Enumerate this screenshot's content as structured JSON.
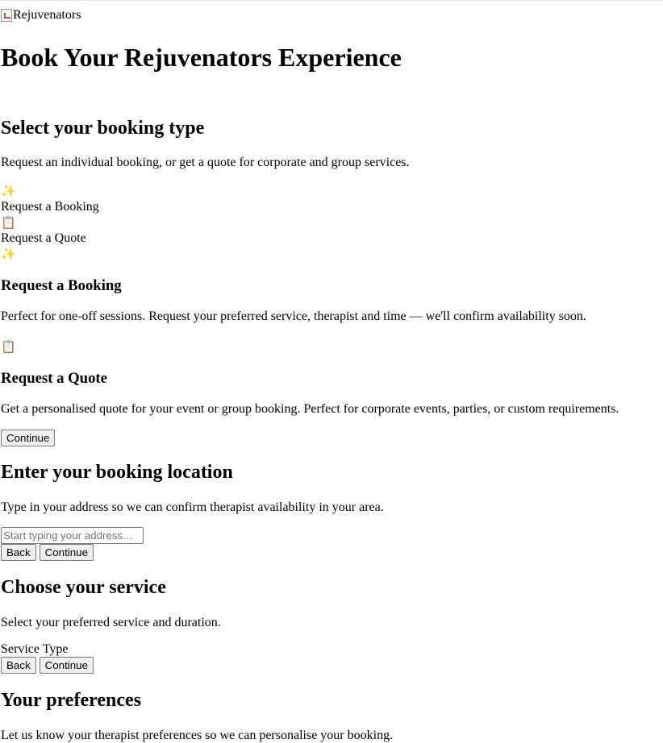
{
  "header": {
    "logo_alt": "Rejuvenators",
    "title": "Book Your Rejuvenators Experience"
  },
  "step_type": {
    "heading": "Select your booking type",
    "description": "Request an individual booking, or get a quote for corporate and group services.",
    "tabs": [
      {
        "icon": "sparkles-icon",
        "glyph": "✨",
        "label": "Request a Booking"
      },
      {
        "icon": "clipboard-icon",
        "glyph": "📋",
        "label": "Request a Quote"
      }
    ],
    "cards": [
      {
        "icon": "sparkles-icon",
        "glyph": "✨",
        "title": "Request a Booking",
        "text": "Perfect for one-off sessions. Request your preferred service, therapist and time — we'll confirm availability soon."
      },
      {
        "icon": "clipboard-icon",
        "glyph": "📋",
        "title": "Request a Quote",
        "text": "Get a personalised quote for your event or group booking. Perfect for corporate events, parties, or custom requirements."
      }
    ],
    "continue_label": "Continue"
  },
  "step_location": {
    "heading": "Enter your booking location",
    "description": "Type in your address so we can confirm therapist availability in your area.",
    "address_placeholder": "Start typing your address...",
    "address_value": "",
    "back_label": "Back",
    "continue_label": "Continue"
  },
  "step_service": {
    "heading": "Choose your service",
    "description": "Select your preferred service and duration.",
    "service_type_label": "Service Type",
    "back_label": "Back",
    "continue_label": "Continue"
  },
  "step_preferences": {
    "heading": "Your preferences",
    "description": "Let us know your therapist preferences so we can personalise your booking."
  }
}
